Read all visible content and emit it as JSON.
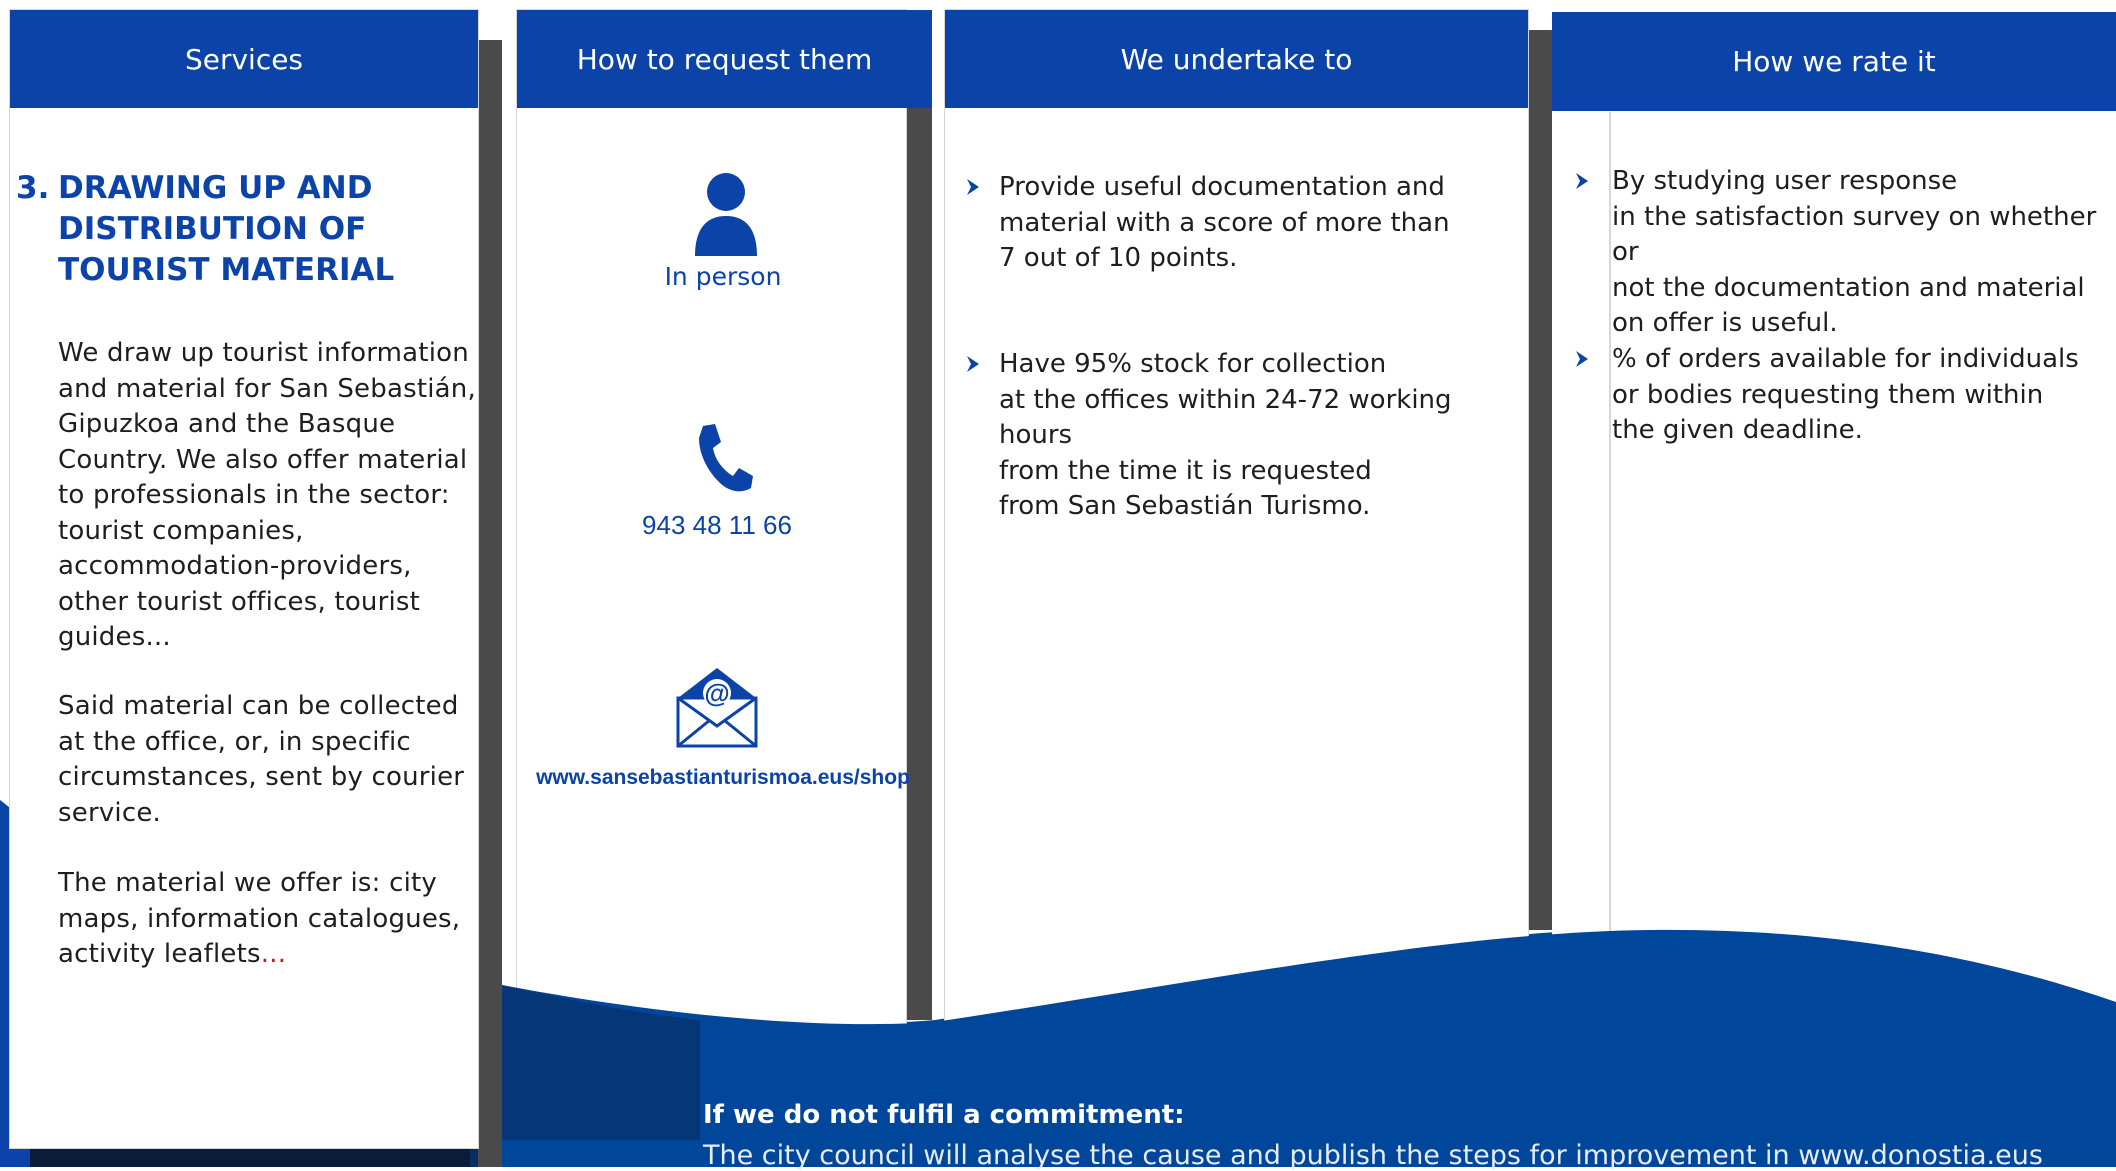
{
  "columns": {
    "services": {
      "header": "Services",
      "number": "3.",
      "title_lines": [
        "DRAWING UP AND",
        "DISTRIBUTION OF",
        "TOURIST MATERIAL"
      ],
      "para1": "We draw up tourist information and material for San Sebastián, Gipuzkoa and the Basque Country. We also offer material to professionals in the sector: tourist companies, accommodation-providers, other tourist offices, tourist guides...",
      "para2": "Said material can be collected at the office, or, in specific circumstances, sent by courier service.",
      "para3_main": "The material we offer is: city maps, information catalogues, activity leaflets",
      "para3_ellipsis": "..."
    },
    "request": {
      "header": "How to request them",
      "in_person_label": "In person",
      "phone": "943 48 11 66",
      "web": "www.sansebastianturismoa.eus/shop",
      "icons": [
        "person-icon",
        "phone-icon",
        "envelope-at-icon"
      ]
    },
    "undertake": {
      "header": "We undertake to",
      "items": [
        "Provide useful documentation and\nmaterial with a score of more than\n7 out of 10 points.",
        "Have 95% stock for collection\nat the offices within 24-72 working hours\nfrom the time it is requested\nfrom San Sebastián Turismo."
      ]
    },
    "rate": {
      "header": "How we rate it",
      "items": [
        "By studying user response\nin the satisfaction survey on whether or\nnot the documentation and material\non offer is useful.",
        "% of orders available for individuals\nor bodies requesting them within\nthe given deadline."
      ]
    }
  },
  "footer": {
    "label": "If we do not fulfil a commitment:",
    "text": "The city council will analyse the cause and publish the steps for improvement in www.donostia.eus"
  },
  "colors": {
    "brand_blue": "#0b43a8",
    "wave_blue": "#00469a",
    "dark_navy": "#0b1b3a",
    "shadow_gray": "#4a4a4a"
  }
}
